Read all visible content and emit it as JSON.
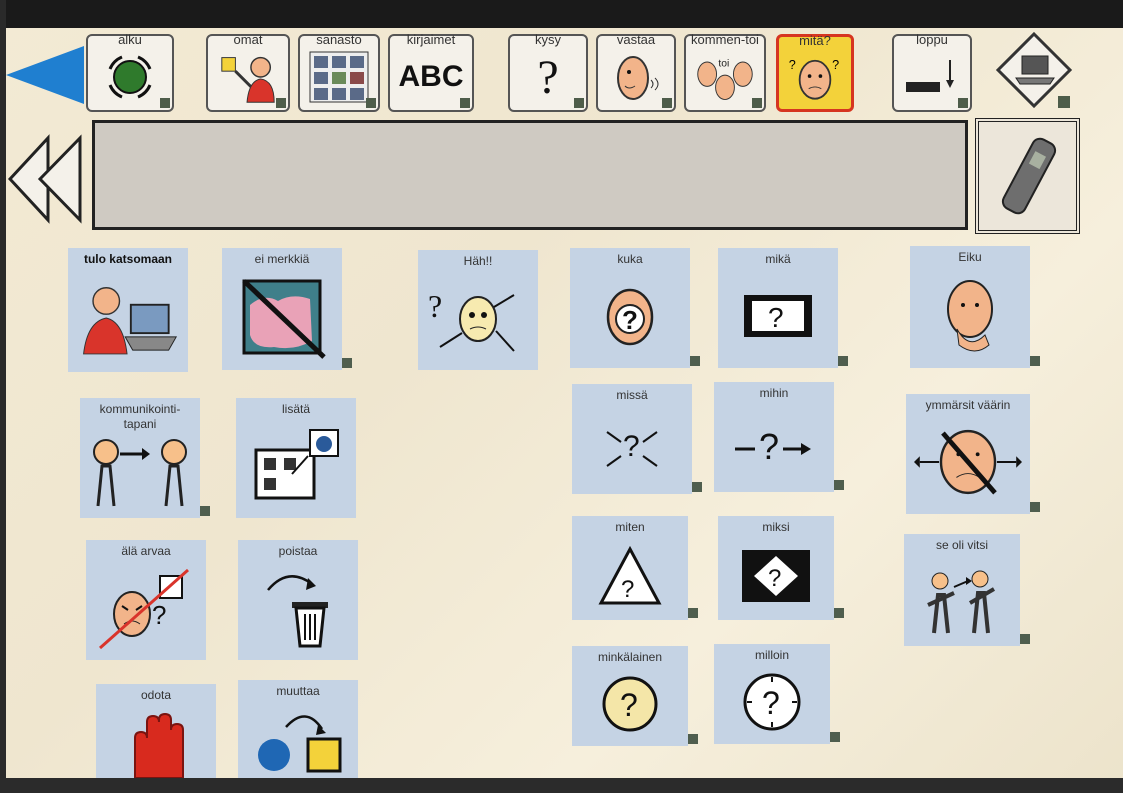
{
  "toolbar": [
    {
      "id": "alku",
      "label": "alku",
      "icon": "start-circle-icon"
    },
    {
      "id": "omat",
      "label": "omat",
      "icon": "person-pointing-icon"
    },
    {
      "id": "sanasto",
      "label": "sanasto",
      "icon": "vocabulary-grid-icon"
    },
    {
      "id": "kirjaimet",
      "label": "kirjaimet",
      "icon": "abc-icon",
      "text": "ABC"
    },
    {
      "id": "kysy",
      "label": "kysy",
      "icon": "question-mark-icon",
      "text": "?"
    },
    {
      "id": "vastaa",
      "label": "vastaa",
      "icon": "speaking-face-icon"
    },
    {
      "id": "kommentoi",
      "label": "kommen-toi",
      "icon": "faces-group-icon",
      "extra": "toi"
    },
    {
      "id": "mita",
      "label": "mitä?",
      "icon": "confused-face-icon",
      "active": true
    },
    {
      "id": "loppu",
      "label": "loppu",
      "icon": "end-keyboard-icon"
    }
  ],
  "cells": [
    {
      "id": "tulo-katsomaan",
      "label": "tulo katsomaan"
    },
    {
      "id": "ei-merkkia",
      "label": "ei merkkiä"
    },
    {
      "id": "hah",
      "label": "Häh!!"
    },
    {
      "id": "kuka",
      "label": "kuka",
      "text": "?"
    },
    {
      "id": "mika",
      "label": "mikä",
      "text": "?"
    },
    {
      "id": "eiku",
      "label": "Eiku"
    },
    {
      "id": "kommunikointitapani",
      "label": "kommunikointi-tapani"
    },
    {
      "id": "lisata",
      "label": "lisätä"
    },
    {
      "id": "missa",
      "label": "missä",
      "text": "?"
    },
    {
      "id": "mihin",
      "label": "mihin",
      "text": "?"
    },
    {
      "id": "ymmarsit-vaarin",
      "label": "ymmärsit väärin"
    },
    {
      "id": "ala-arvaa",
      "label": "älä arvaa",
      "text": "?"
    },
    {
      "id": "poistaa",
      "label": "poistaa"
    },
    {
      "id": "miten",
      "label": "miten",
      "text": "?"
    },
    {
      "id": "miksi",
      "label": "miksi",
      "text": "?"
    },
    {
      "id": "se-oli-vitsi",
      "label": "se oli vitsi"
    },
    {
      "id": "odota",
      "label": "odota"
    },
    {
      "id": "muuttaa",
      "label": "muuttaa"
    },
    {
      "id": "minkalainen",
      "label": "minkälainen",
      "text": "?"
    },
    {
      "id": "milloin",
      "label": "milloin",
      "text": "?"
    }
  ],
  "colors": {
    "active_border": "#d63520",
    "active_fill": "#f3d23a",
    "cell_bg": "#c5d3e4",
    "back_arrow": "#1f7fd0"
  }
}
